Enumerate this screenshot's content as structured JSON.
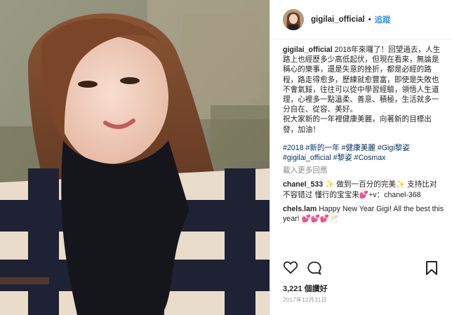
{
  "post": {
    "username": "gigilai_official",
    "follow_label": "追蹤",
    "caption": "2018年來囉了！回望過去，人生路上也經歷多少高低起伏，但現在看來，無論是稱心的樂事，還是失意的挫折，都是必經的路程，路走得愈多，歷練就愈豐富，即使是失敗也不會氣餒，往往可以從中學習經驗，領悟人生道理，心裡多一點溫柔、善意、積極，生活就多一分自在、從容、美好。\n祝大家新的一年裡健康美麗，向著新的目標出發，加油！",
    "hashtags": "#2018 #新的一年 #健康美麗 #Gigi黎姿 #gigilai_official #黎姿 #Cosmax",
    "load_more": "載入更多回應",
    "comments": [
      {
        "user": "chanel_533",
        "text": "✨ 做到一百分的完美✨ 支持比对 不容错过 懂行的宝宝来💕+v：chanel-368"
      },
      {
        "user": "chels.lam",
        "text": "Happy New Year Gigi! All the best this year! 💕💕💕🥂"
      }
    ],
    "likes": "3,221 個讚好",
    "date": "2017年12月31日"
  },
  "icons": {
    "like": "heart-icon",
    "comment": "comment-icon",
    "save": "bookmark-icon"
  },
  "colors": {
    "link": "#3897f0",
    "hashtag": "#003569",
    "muted": "#8e8e8e"
  }
}
